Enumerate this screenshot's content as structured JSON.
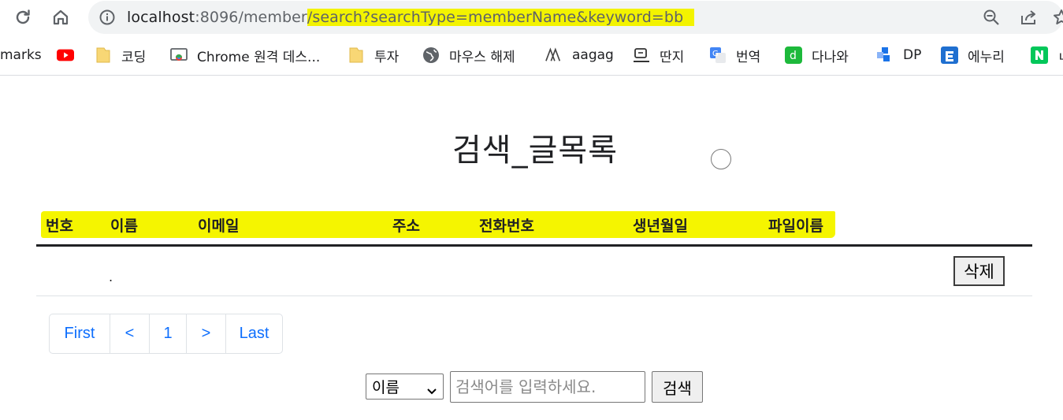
{
  "browser": {
    "url_host": "localhost",
    "url_port_path": ":8096/member",
    "url_highlighted": "/search?searchType=memberName&keyword=bb",
    "bookmarks": [
      {
        "label": "marks",
        "icon": "none"
      },
      {
        "label": "",
        "icon": "youtube-icon"
      },
      {
        "label": "코딩",
        "icon": "folder-icon"
      },
      {
        "label": "Chrome 원격 데스...",
        "icon": "chrome-remote-icon"
      },
      {
        "label": "투자",
        "icon": "folder-icon"
      },
      {
        "label": "마우스 해제",
        "icon": "globe-icon"
      },
      {
        "label": "aagag",
        "icon": "aagag-icon"
      },
      {
        "label": "딴지",
        "icon": "ddanzi-icon"
      },
      {
        "label": "번역",
        "icon": "google-translate-icon"
      },
      {
        "label": "다나와",
        "icon": "danawa-icon"
      },
      {
        "label": "DP",
        "icon": "dp-icon"
      },
      {
        "label": "에누리",
        "icon": "enuri-icon"
      },
      {
        "label": "ㄴ",
        "icon": "naver-icon"
      }
    ]
  },
  "page": {
    "title": "검색_글목록"
  },
  "table": {
    "headers": [
      "번호",
      "이름",
      "이메일",
      "주소",
      "전화번호",
      "생년월일",
      "파일이름"
    ],
    "rows": [
      {
        "name": ".",
        "delete_label": "삭제"
      }
    ]
  },
  "pagination": {
    "items": [
      "First",
      "<",
      "1",
      ">",
      "Last"
    ]
  },
  "search": {
    "select_value": "이름",
    "placeholder": "검색어를 입력하세요.",
    "button_label": "검색"
  },
  "colors": {
    "highlight": "#f5f500",
    "link": "#0d6efd"
  }
}
